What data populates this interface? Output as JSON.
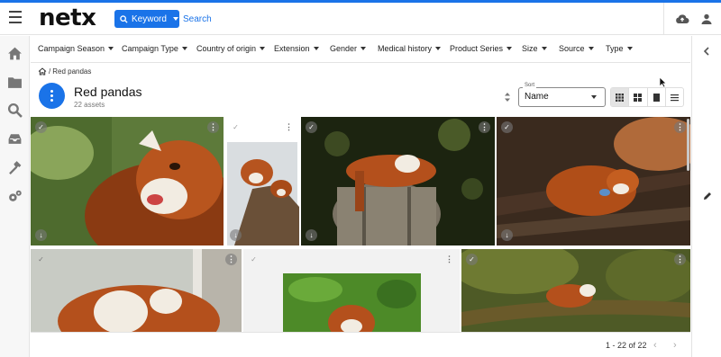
{
  "header": {
    "logo": "netx",
    "keyword_button": "Keyword",
    "search_placeholder": "Search"
  },
  "facets": [
    {
      "label": "Campaign Season"
    },
    {
      "label": "Campaign Type"
    },
    {
      "label": "Country of origin"
    },
    {
      "label": "Extension"
    },
    {
      "label": "Gender"
    },
    {
      "label": "Medical history"
    },
    {
      "label": "Product Series"
    },
    {
      "label": "Size"
    },
    {
      "label": "Source"
    },
    {
      "label": "Type"
    }
  ],
  "breadcrumb": {
    "separator": "/",
    "current": "Red pandas"
  },
  "folder": {
    "title": "Red pandas",
    "count": "22 assets"
  },
  "sort": {
    "legend": "Sort",
    "value": "Name"
  },
  "pagination": {
    "range": "1 - 22 of 22",
    "prev": "‹",
    "next": "›"
  },
  "tile_icons": {
    "check": "✓",
    "menu": "⋮",
    "download": "↓"
  },
  "colors": {
    "accent": "#1a73e8"
  }
}
